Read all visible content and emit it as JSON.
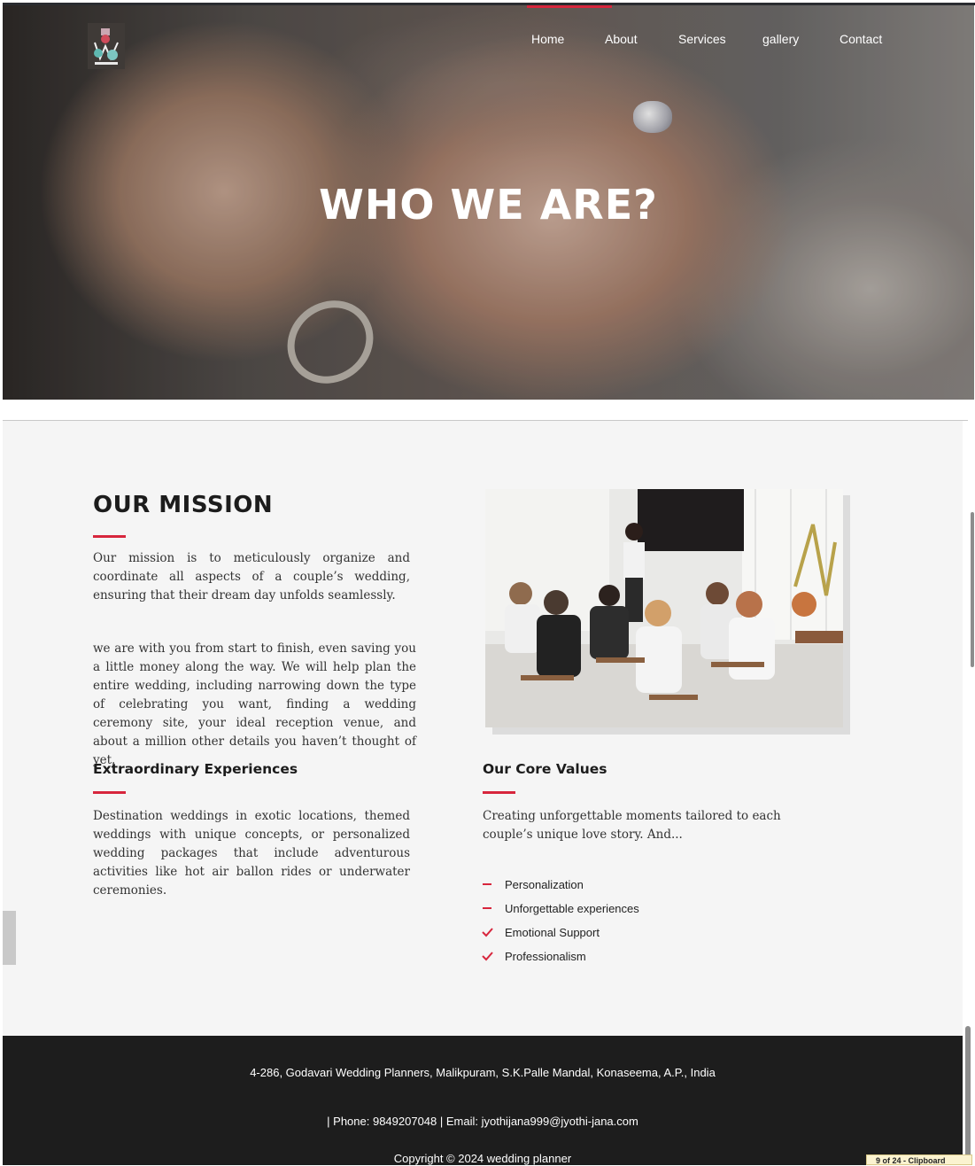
{
  "nav": {
    "items": [
      {
        "label": "Home"
      },
      {
        "label": "About"
      },
      {
        "label": "Services"
      },
      {
        "label": "gallery"
      },
      {
        "label": "Contact"
      }
    ],
    "active": "Home",
    "accent_color": "#d7263d"
  },
  "hero": {
    "title": "WHO WE ARE?"
  },
  "mission": {
    "heading": "OUR MISSION",
    "paragraph1": "Our mission is to meticulously organize and coordinate all aspects of a couple’s wedding, ensuring that their dream day unfolds seamlessly.",
    "paragraph2": "we are with you from start to finish, even saving you a little money along the way. We will help plan the entire wedding, including narrowing down the type of celebrating you want, finding a wedding ceremony site, your ideal reception venue, and about a million other details you haven’t thought of yet."
  },
  "experiences": {
    "heading": "Extraordinary Experiences",
    "text": "Destination weddings in exotic locations, themed weddings with unique concepts, or personalized wedding packages that include adventurous activities like hot air ballon rides or underwater ceremonies."
  },
  "core_values": {
    "heading": "Our Core Values",
    "text": "Creating unforgettable moments tailored to each couple’s unique love story. And...",
    "items": [
      {
        "label": "Personalization",
        "icon": "dash-icon"
      },
      {
        "label": "Unforgettable experiences",
        "icon": "dash-icon"
      },
      {
        "label": "Emotional Support",
        "icon": "check-icon"
      },
      {
        "label": "Professionalism",
        "icon": "check-icon"
      }
    ]
  },
  "footer": {
    "address": "4-286, Godavari Wedding Planners, Malikpuram, S.K.Palle Mandal, Konaseema, A.P., India",
    "contact": "| Phone: 9849207048 | Email: jyothijana999@jyothi-jana.com",
    "copyright": "Copyright © 2024 wedding planner"
  },
  "clipboard_badge": "9 of 24 - Clipboard"
}
